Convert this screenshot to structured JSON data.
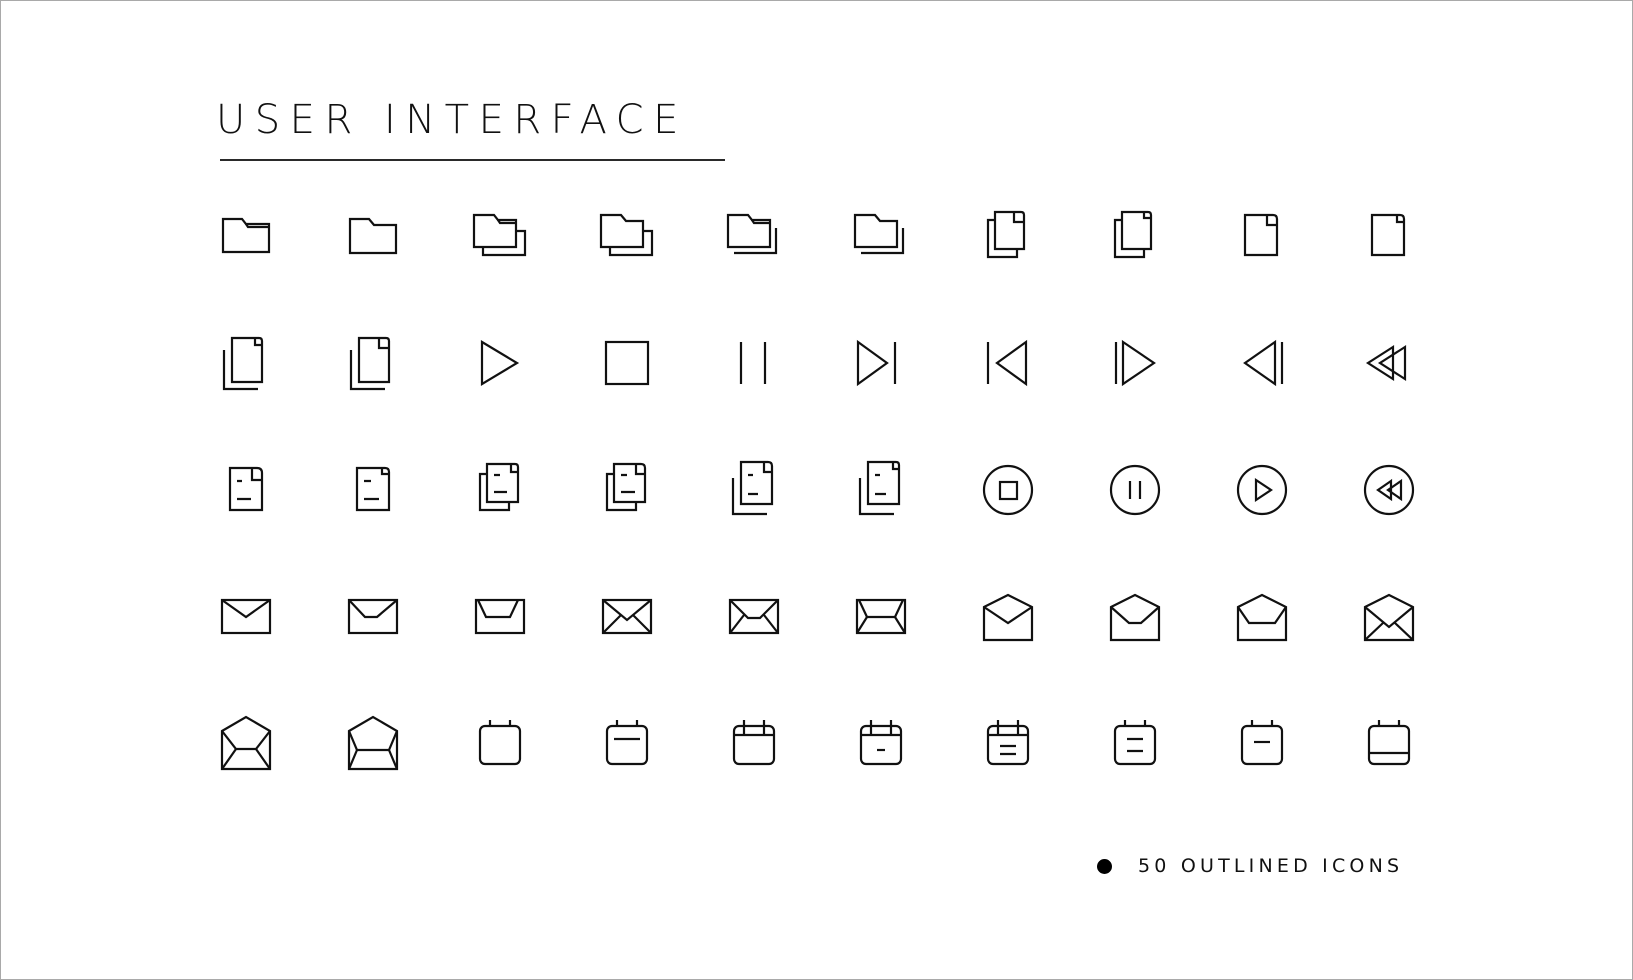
{
  "header": {
    "title": "USER INTERFACE"
  },
  "footer": {
    "label": "50 OUTLINED ICONS"
  },
  "icon_grid": {
    "columns": 10,
    "rows": 5,
    "icons": [
      "folder-tab-icon",
      "folder-icon",
      "folders-stacked-tab-icon",
      "folders-stacked-icon",
      "folders-offset-tab-icon",
      "folders-offset-icon",
      "documents-stacked-icon",
      "documents-stacked-small-corner-icon",
      "document-icon",
      "document-small-corner-icon",
      "documents-offset-icon",
      "documents-offset-large-corner-icon",
      "play-icon",
      "stop-icon",
      "pause-icon",
      "skip-forward-icon",
      "skip-back-icon",
      "step-forward-icon",
      "step-back-icon",
      "rewind-icon",
      "text-document-icon",
      "text-document-small-icon",
      "text-documents-stacked-icon",
      "text-documents-stacked-alt-icon",
      "text-documents-offset-icon",
      "text-documents-offset-alt-icon",
      "stop-circle-icon",
      "pause-circle-icon",
      "play-circle-icon",
      "rewind-circle-icon",
      "envelope-icon",
      "envelope-flat-flap-icon",
      "envelope-wide-flap-icon",
      "envelope-cross-icon",
      "envelope-cross-flat-icon",
      "envelope-cross-wide-icon",
      "envelope-open-icon",
      "envelope-open-flat-icon",
      "envelope-open-wide-icon",
      "envelope-open-cross-icon",
      "envelope-open-letter-icon",
      "envelope-open-letter-wide-icon",
      "calendar-icon",
      "calendar-line-icon",
      "calendar-header-icon",
      "calendar-header-dash-icon",
      "calendar-header-lines-icon",
      "calendar-lines-icon",
      "calendar-dash-icon",
      "calendar-footer-icon"
    ]
  }
}
